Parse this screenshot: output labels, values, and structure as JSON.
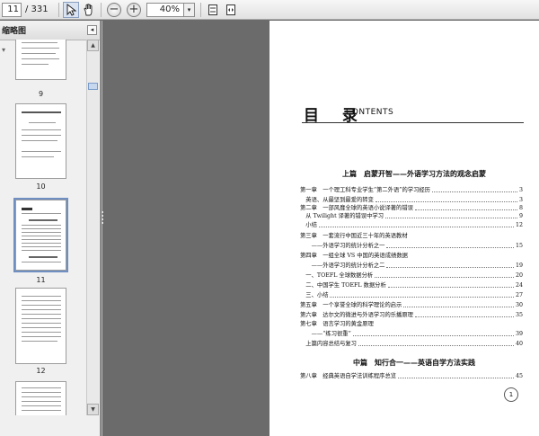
{
  "toolbar": {
    "page_current": "11",
    "page_total": "/ 331",
    "zoom": "40%",
    "zoom_dropdown_icon": "▾"
  },
  "panel": {
    "title": "缩略图",
    "collapse_icon": "◂",
    "options_icon": "▾",
    "delete_icon": "🗑"
  },
  "thumbnails": [
    {
      "label": "9"
    },
    {
      "label": "10"
    },
    {
      "label": "11"
    },
    {
      "label": "12"
    }
  ],
  "document": {
    "title": "目 录",
    "title_en": "CONTENTS",
    "parts": [
      "上篇　启蒙开智——外语学习方法的观念启蒙",
      "中篇　知行合一——英语自学方法实践"
    ],
    "entries": [
      {
        "text": "第一章　一个理工科专业学生“第二外语”的学习经历",
        "page": "3"
      },
      {
        "text": "　英语、从最坚到最爱的转变",
        "page": "3"
      },
      {
        "text": "第二章　一部风靡全球的英语小说译著的错误",
        "page": "8"
      },
      {
        "text": "　从 Twilight 译著的错误中学习",
        "page": "9"
      },
      {
        "text": "　小结",
        "page": "12"
      },
      {
        "text": "第三章　一套流行中国近三十年的英语教材",
        "page": ""
      },
      {
        "text": "　　——外语学习的统计分析之一",
        "page": "15"
      },
      {
        "text": "第四章　一组全球 VS 中国的英语成绩数据",
        "page": ""
      },
      {
        "text": "　　——外语学习的统计分析之二",
        "page": "19"
      },
      {
        "text": "　一、TOEFL 全球数据分析",
        "page": "20"
      },
      {
        "text": "　二、中国学生 TOEFL 数据分析",
        "page": "24"
      },
      {
        "text": "　三、小结",
        "page": "27"
      },
      {
        "text": "第五章　一个享誉全球的科学理论的启示",
        "page": "30"
      },
      {
        "text": "第六章　达尔文的微进与外语学习的乐播原理",
        "page": "35"
      },
      {
        "text": "第七章　语言学习的黄金原理",
        "page": ""
      },
      {
        "text": "　　——“练习很重”",
        "page": "39"
      },
      {
        "text": "　上篇内容总结与复习",
        "page": "40"
      },
      {
        "text": "第八章　经典英语自学法训练程序总览",
        "page": "45"
      }
    ],
    "page_number": "1"
  }
}
